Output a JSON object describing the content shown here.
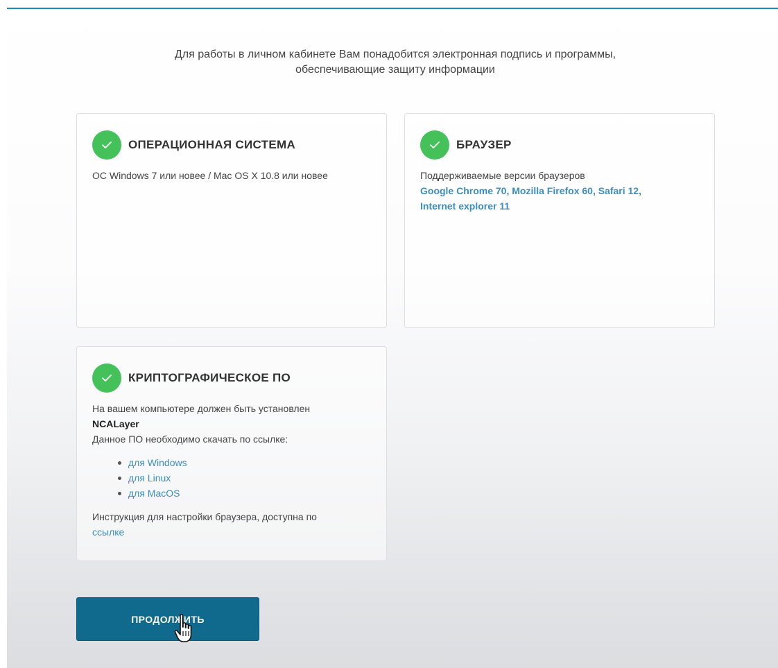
{
  "intro": {
    "line1": "Для работы в личном кабинете Вам понадобится электронная подпись и программы,",
    "line2": "обеспечивающие защиту информации"
  },
  "cards": {
    "os": {
      "title": "ОПЕРАЦИОННАЯ СИСТЕМА",
      "text": "ОС Windows 7 или новее / Mac OS X 10.8 или новее",
      "icon": "check-icon"
    },
    "browser": {
      "title": "БРАУЗЕР",
      "text": "Поддерживаемые версии браузеров",
      "supported_line1": "Google Chrome 70, Mozilla Firefox 60, Safari 12,",
      "supported_line2": "Internet explorer 11",
      "icon": "check-icon"
    },
    "crypto": {
      "title": "КРИПТОГРАФИЧЕСКОЕ ПО",
      "text": "На вашем компьютере должен быть установлен",
      "software_name": "NCALayer",
      "download_text": "Данное ПО необходимо скачать по ссылке:",
      "downloads": [
        {
          "label": "для Windows"
        },
        {
          "label": "для Linux"
        },
        {
          "label": "для MacOS"
        }
      ],
      "instructions_text": "Инструкция для настройки браузера, доступна по",
      "instructions_link": "ссылке",
      "icon": "check-icon"
    }
  },
  "continue_button": {
    "label": "ПРОДОЛЖИТЬ"
  },
  "colors": {
    "accent_line": "#1a8ac0",
    "check_green": "#45c15a",
    "link_blue": "#3b8ec2",
    "button_bg": "#0f6a8d"
  }
}
